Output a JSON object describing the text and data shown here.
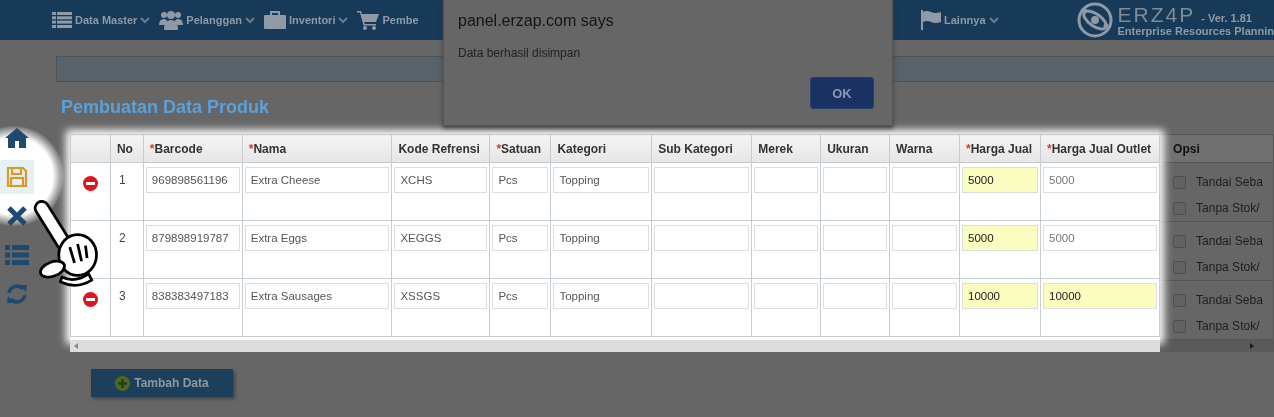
{
  "nav": {
    "items": [
      {
        "label": "Data Master",
        "kind": "list",
        "chevron": true
      },
      {
        "label": "Pelanggan",
        "kind": "users",
        "chevron": true
      },
      {
        "label": "Inventori",
        "kind": "briefcase",
        "chevron": true
      },
      {
        "label": "Pembe",
        "kind": "cart",
        "chevron": false
      },
      {
        "label": "Lainnya",
        "kind": "flag",
        "chevron": true
      }
    ],
    "brand": {
      "logo": "ERZ4P",
      "version": "- Ver. 1.81",
      "tagline": "Enterprise Resources Plannin"
    }
  },
  "sidebar": [
    {
      "kind": "home",
      "selected": false
    },
    {
      "kind": "save",
      "selected": true
    },
    {
      "kind": "close",
      "selected": false
    },
    {
      "kind": "list",
      "selected": false
    },
    {
      "kind": "refresh",
      "selected": false
    }
  ],
  "page_title": "Pembuatan Data Produk",
  "table": {
    "columns": [
      {
        "kind": "blank"
      },
      {
        "kind": "text",
        "label": "No",
        "required": false
      },
      {
        "kind": "text",
        "label": "Barcode",
        "required": true
      },
      {
        "kind": "text",
        "label": "Nama",
        "required": true
      },
      {
        "kind": "text",
        "label": "Kode Refrensi",
        "required": false
      },
      {
        "kind": "text",
        "label": "Satuan",
        "required": true
      },
      {
        "kind": "text",
        "label": "Kategori",
        "required": false
      },
      {
        "kind": "text",
        "label": "Sub Kategori",
        "required": false
      },
      {
        "kind": "text",
        "label": "Merek",
        "required": false
      },
      {
        "kind": "text",
        "label": "Ukuran",
        "required": false
      },
      {
        "kind": "text",
        "label": "Warna",
        "required": false
      },
      {
        "kind": "text",
        "label": "Harga Jual",
        "required": true
      },
      {
        "kind": "text",
        "label": "Harga Jual Outlet",
        "required": true
      },
      {
        "kind": "text",
        "label": "Opsi",
        "required": false
      }
    ],
    "required_mark": "*",
    "rows": [
      {
        "cells": [
          {
            "kind": "action",
            "delete_icon": true
          },
          {
            "kind": "number",
            "value": "1"
          },
          {
            "kind": "input",
            "value": "969898561196",
            "highlighted": false
          },
          {
            "kind": "input",
            "value": "Extra Cheese",
            "highlighted": false
          },
          {
            "kind": "input",
            "value": "XCHS",
            "highlighted": false
          },
          {
            "kind": "input",
            "value": "Pcs",
            "highlighted": false
          },
          {
            "kind": "input",
            "value": "Topping",
            "highlighted": false
          },
          {
            "kind": "input",
            "highlighted": false
          },
          {
            "kind": "input",
            "highlighted": false
          },
          {
            "kind": "input",
            "highlighted": false
          },
          {
            "kind": "input",
            "highlighted": false
          },
          {
            "kind": "input",
            "value": "5000",
            "highlighted": true
          },
          {
            "kind": "input",
            "placeholder": "5000",
            "highlighted": false
          },
          {
            "kind": "options",
            "options": [
              {
                "label": "Tandai Seba",
                "checked": false
              },
              {
                "label": "Tanpa Stok/",
                "checked": false
              }
            ]
          }
        ]
      },
      {
        "cells": [
          {
            "kind": "action",
            "delete_icon": false
          },
          {
            "kind": "number",
            "value": "2"
          },
          {
            "kind": "input",
            "value": "879898919787",
            "highlighted": false
          },
          {
            "kind": "input",
            "value": "Extra Eggs",
            "highlighted": false
          },
          {
            "kind": "input",
            "value": "XEGGS",
            "highlighted": false
          },
          {
            "kind": "input",
            "value": "Pcs",
            "highlighted": false
          },
          {
            "kind": "input",
            "value": "Topping",
            "highlighted": false
          },
          {
            "kind": "input",
            "highlighted": false
          },
          {
            "kind": "input",
            "highlighted": false
          },
          {
            "kind": "input",
            "highlighted": false
          },
          {
            "kind": "input",
            "highlighted": false
          },
          {
            "kind": "input",
            "value": "5000",
            "highlighted": true
          },
          {
            "kind": "input",
            "placeholder": "5000",
            "highlighted": false
          },
          {
            "kind": "options",
            "options": [
              {
                "label": "Tandai Seba",
                "checked": false
              },
              {
                "label": "Tanpa Stok/",
                "checked": false
              }
            ]
          }
        ]
      },
      {
        "cells": [
          {
            "kind": "action",
            "delete_icon": true
          },
          {
            "kind": "number",
            "value": "3"
          },
          {
            "kind": "input",
            "value": "838383497183",
            "highlighted": false
          },
          {
            "kind": "input",
            "value": "Extra Sausages",
            "highlighted": false
          },
          {
            "kind": "input",
            "value": "XSSGS",
            "highlighted": false
          },
          {
            "kind": "input",
            "value": "Pcs",
            "highlighted": false
          },
          {
            "kind": "input",
            "value": "Topping",
            "highlighted": false
          },
          {
            "kind": "input",
            "highlighted": false
          },
          {
            "kind": "input",
            "highlighted": false
          },
          {
            "kind": "input",
            "highlighted": false
          },
          {
            "kind": "input",
            "highlighted": false
          },
          {
            "kind": "input",
            "value": "10000",
            "highlighted": true
          },
          {
            "kind": "input",
            "value": "10000",
            "highlighted": true
          },
          {
            "kind": "options",
            "options": [
              {
                "label": "Tandai Seba",
                "checked": false
              },
              {
                "label": "Tanpa Stok/",
                "checked": false
              }
            ]
          }
        ]
      }
    ]
  },
  "add_button": "Tambah Data",
  "dialog": {
    "title": "panel.erzap.com says",
    "message": "Data berhasil disimpan",
    "button": "OK"
  }
}
